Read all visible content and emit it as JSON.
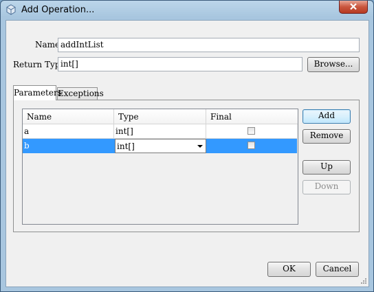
{
  "window": {
    "title": "Add Operation..."
  },
  "form": {
    "name_label": "Name:",
    "name_value": "addIntList",
    "return_type_label": "Return Type:",
    "return_type_value": "int[]",
    "browse_label": "Browse..."
  },
  "tabs": [
    {
      "label": "Parameters",
      "active": true
    },
    {
      "label": "Exceptions",
      "active": false
    }
  ],
  "parameters": {
    "columns": [
      "Name",
      "Type",
      "Final"
    ],
    "rows": [
      {
        "name": "a",
        "type": "int[]",
        "final": false,
        "selected": false
      },
      {
        "name": "b",
        "type": "int[]",
        "final": false,
        "selected": true
      }
    ]
  },
  "side_buttons": {
    "add": "Add",
    "remove": "Remove",
    "up": "Up",
    "down": "Down"
  },
  "footer": {
    "ok": "OK",
    "cancel": "Cancel"
  },
  "colors": {
    "selection": "#3399ff",
    "close_button": "#c9563d"
  },
  "icons": {
    "app": "netbeans-cube-icon",
    "close": "close-icon",
    "dropdown": "chevron-down-icon"
  }
}
